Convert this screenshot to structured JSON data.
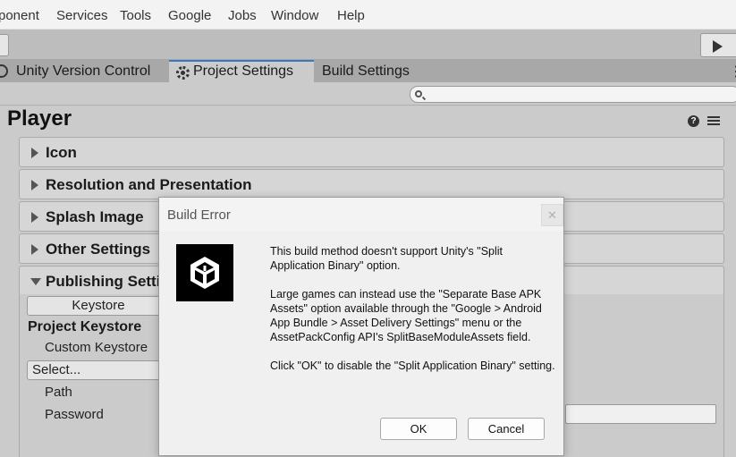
{
  "menubar": {
    "items": [
      "ponent",
      "Services",
      "Tools",
      "Google",
      "Jobs",
      "Window",
      "Help"
    ]
  },
  "tabs": {
    "unity_version_control": "Unity Version Control",
    "project_settings": "Project Settings",
    "build_settings": "Build Settings",
    "more": "⋮"
  },
  "search": {
    "placeholder": "",
    "value": ""
  },
  "player": {
    "title": "Player",
    "help": "?",
    "more": "⋮",
    "sections": [
      "Icon",
      "Resolution and Presentation",
      "Splash Image",
      "Other Settings",
      "Publishing Setti"
    ],
    "publishing": {
      "keystore_button": "Keystore",
      "keystore_heading": "Project Keystore",
      "custom_keystore": "Custom Keystore",
      "select": "Select...",
      "path": "Path",
      "password": "Password"
    }
  },
  "dialog": {
    "title": "Build Error",
    "close": "✕",
    "paragraph1": "This build method doesn't support Unity's \"Split Application Binary\" option.",
    "paragraph2": "Large games can instead use the \"Separate Base APK Assets\" option available through the \"Google > Android App Bundle > Asset Delivery Settings\" menu or the AssetPackConfig API's SplitBaseModuleAssets field.",
    "paragraph3": "Click \"OK\" to disable the \"Split Application Binary\" setting.",
    "ok": "OK",
    "cancel": "Cancel"
  },
  "colors": {
    "accent_tab": "#3a79bb",
    "logo_bg": "#000000"
  }
}
